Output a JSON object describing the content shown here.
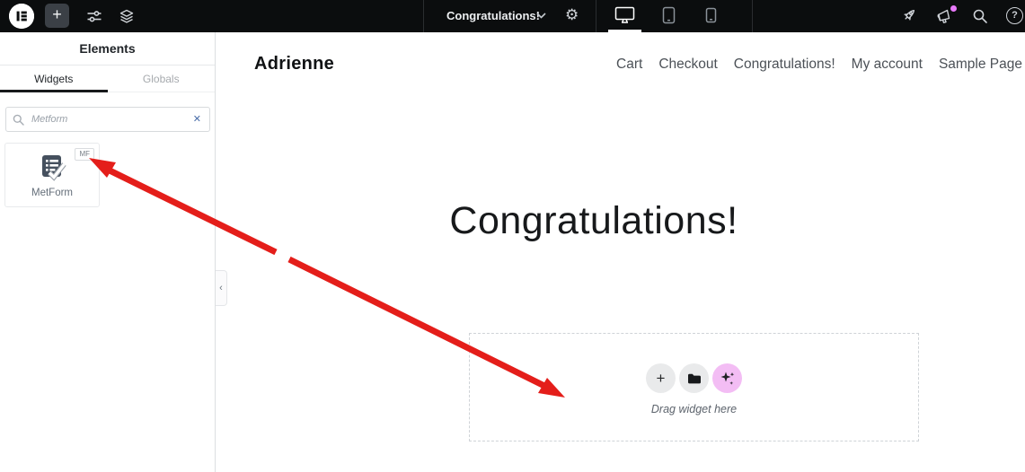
{
  "topbar": {
    "document_name": "Congratulations!",
    "plus_glyph": "+",
    "gear_glyph": "⚙",
    "help_glyph": "?"
  },
  "panel": {
    "title": "Elements",
    "tabs": [
      {
        "label": "Widgets",
        "active": true
      },
      {
        "label": "Globals",
        "active": false
      }
    ],
    "search_value": "Metform",
    "clear_glyph": "✕",
    "widget": {
      "badge": "MF",
      "label": "MetForm"
    },
    "collapse_glyph": "‹"
  },
  "preview": {
    "site_title": "Adrienne",
    "nav": [
      "Cart",
      "Checkout",
      "Congratulations!",
      "My account",
      "Sample Page"
    ],
    "heading": "Congratulations!",
    "dropzone": {
      "hint": "Drag widget here",
      "plus_glyph": "+"
    }
  },
  "colors": {
    "topbar_bg": "#0b0d0e",
    "arrow_red": "#e41e1a",
    "ai_pink": "#f3bdf4",
    "notification_pink": "#e879f9",
    "active_tab_underline": "#17191b",
    "search_clear_blue": "#4b6ea9"
  }
}
